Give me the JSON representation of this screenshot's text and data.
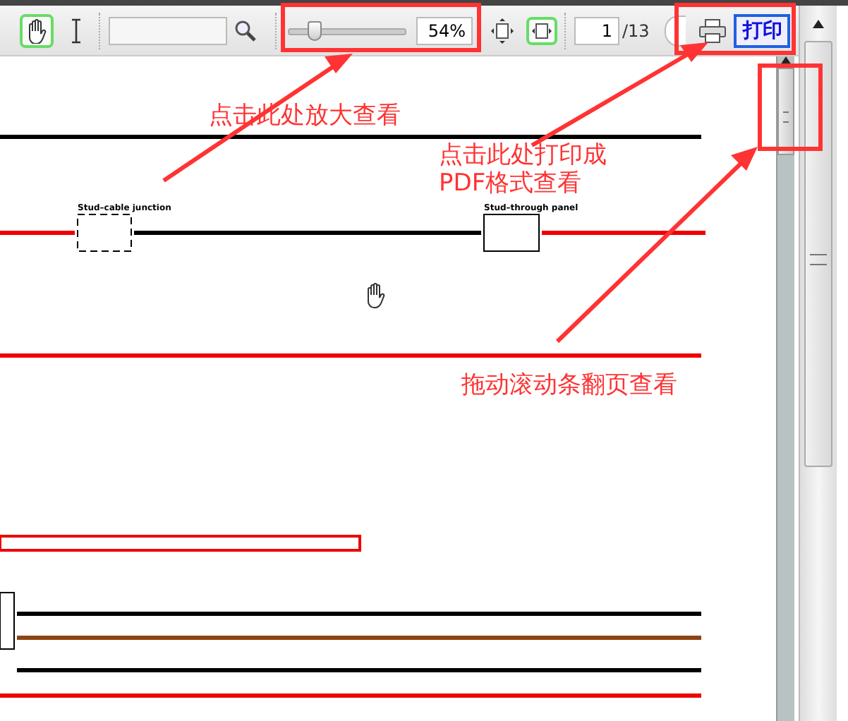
{
  "toolbar": {
    "tools": [
      {
        "kind": "hand",
        "selected": true
      },
      {
        "kind": "text",
        "selected": false
      }
    ],
    "zoom": {
      "level": 0.2,
      "value": "54%"
    },
    "fit": [
      {
        "kind": "page",
        "selected": false
      },
      {
        "kind": "width",
        "selected": true
      }
    ],
    "page": {
      "value": "1",
      "total": "/13"
    },
    "print_button": "打印"
  },
  "diagram": {
    "labels": [
      "Stud–cable junction",
      "Stud–through panel"
    ]
  },
  "annotations": [
    {
      "lines": [
        "点击此处放大查看"
      ]
    },
    {
      "lines": [
        "点击此处打印成",
        "PDF格式查看"
      ]
    },
    {
      "lines": [
        "拖动滚动条翻页查看"
      ]
    }
  ]
}
